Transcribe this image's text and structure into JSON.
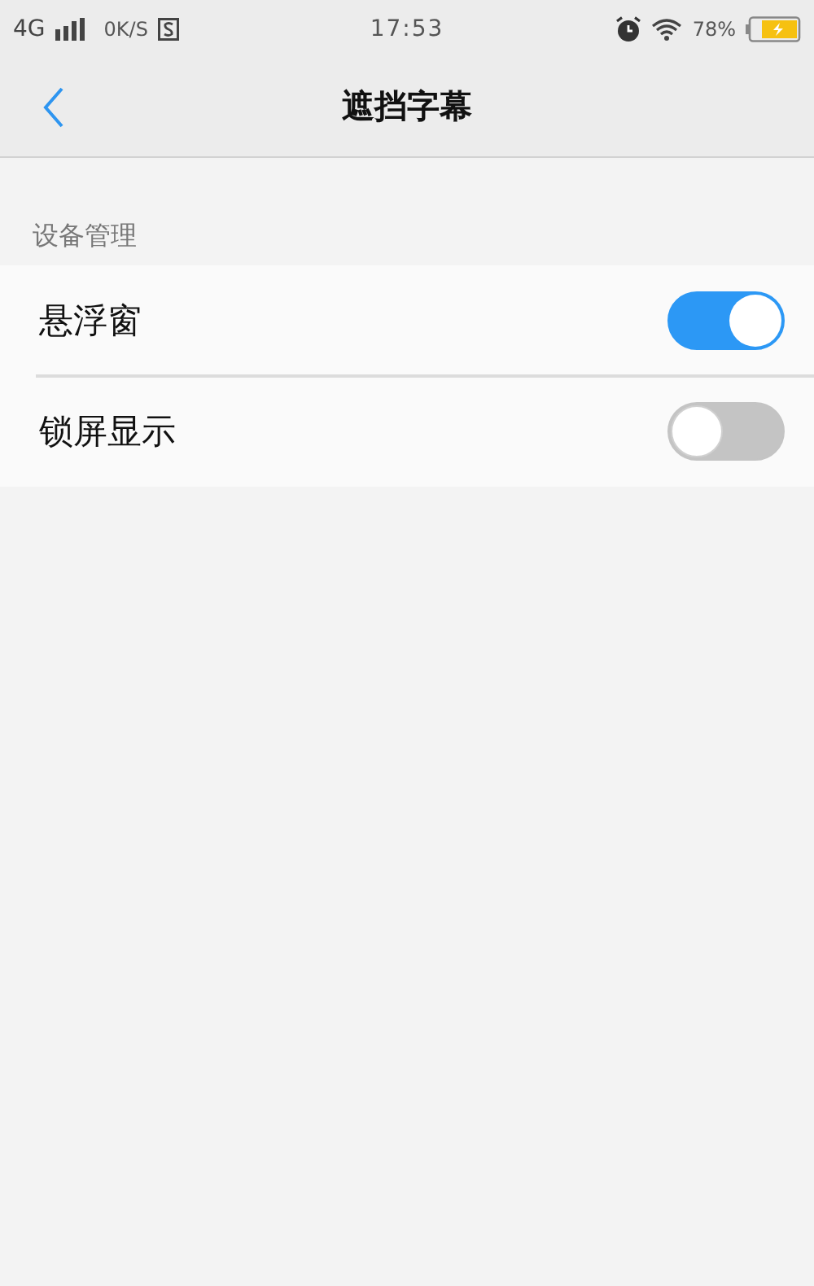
{
  "status_bar": {
    "network": "4G",
    "speed": "0K/S",
    "time": "17:53",
    "battery": "78%"
  },
  "header": {
    "title": "遮挡字幕"
  },
  "section": {
    "title": "设备管理",
    "items": [
      {
        "label": "悬浮窗",
        "on": true
      },
      {
        "label": "锁屏显示",
        "on": false
      }
    ]
  }
}
